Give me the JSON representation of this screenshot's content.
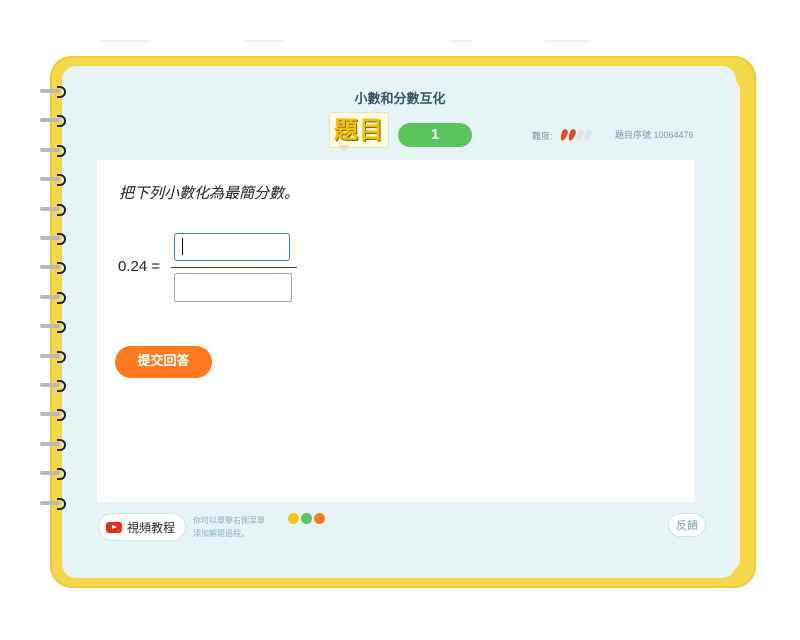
{
  "header": {
    "topic_title": "小數和分數互化",
    "question_badge": "題目",
    "question_number": "1",
    "difficulty_label": "難度:",
    "difficulty_level": 2,
    "difficulty_max": 4,
    "serial_label": "題目序號 10064476"
  },
  "question": {
    "prompt": "把下列小數化為最簡分數。",
    "lhs": "0.24 =",
    "numerator_value": "",
    "denominator_value": "",
    "submit_label": "提交回答"
  },
  "footer": {
    "video_label": "視頻教程",
    "hint_line1": "你可以單擊右側菜單",
    "hint_line2": "添加解題過程。",
    "hint_icons": [
      {
        "name": "pencil-icon",
        "color": "#f5c518"
      },
      {
        "name": "text-icon",
        "color": "#5cc45c"
      },
      {
        "name": "fraction-icon",
        "color": "#ff7a1f"
      }
    ],
    "feedback_label": "反饋"
  },
  "colors": {
    "notebook_frame": "#f5d84a",
    "page_bg": "#e6f4f6",
    "accent_green": "#5cc45c",
    "accent_orange": "#ff7a1f",
    "input_focus": "#3d7fcc"
  }
}
